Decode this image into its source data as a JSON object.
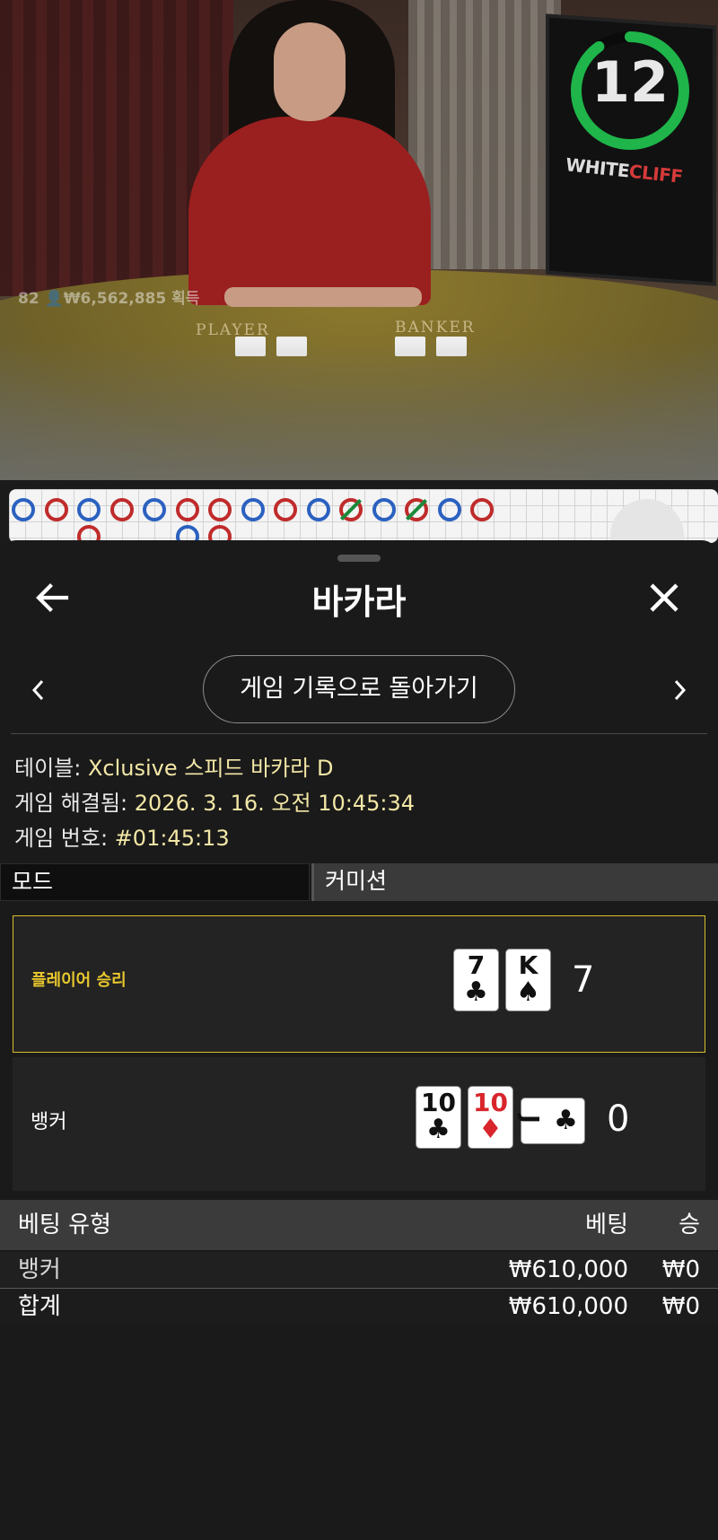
{
  "video": {
    "timer_value": "12",
    "win_text": "82 👤₩6,562,885 획득",
    "felt_player_label": "PLAYER",
    "felt_banker_label": "BANKER",
    "monitor_logo_white": "WHITE",
    "monitor_logo_red": "CLIFF",
    "timer_color": "#1fb54a"
  },
  "road": {
    "beads": [
      "B",
      "R",
      "B",
      "R",
      "B",
      "R",
      "R",
      "B",
      "R",
      "B",
      "T",
      "B",
      "T",
      "B",
      "R"
    ],
    "colors": {
      "banker": "#c02b2b",
      "player": "#2b61c0",
      "tie": "#1a8a3a"
    }
  },
  "header": {
    "title": "바카라",
    "back_icon": "arrow-left-icon",
    "close_icon": "close-icon"
  },
  "nav": {
    "back_to_history_label": "게임 기록으로 돌아가기",
    "prev_icon": "chevron-left-icon",
    "next_icon": "chevron-right-icon"
  },
  "info": {
    "table_label": "테이블:",
    "table_value": "Xclusive 스피드 바카라 D",
    "resolved_label": "게임 해결됨:",
    "resolved_value": "2026. 3. 16. 오전 10:45:34",
    "game_no_label": "게임 번호:",
    "game_no_value": "#01:45:13"
  },
  "tabs": {
    "mode_label": "모드",
    "commission_label": "커미션"
  },
  "results": {
    "player": {
      "label": "플레이어 승리",
      "cards": [
        {
          "rank": "7",
          "suit": "♣"
        },
        {
          "rank": "K",
          "suit": "♠"
        }
      ],
      "score": "7"
    },
    "banker": {
      "label": "뱅커",
      "cards": [
        {
          "rank": "10",
          "suit": "♣"
        },
        {
          "rank": "10",
          "suit": "♦"
        },
        {
          "rank": "J",
          "suit": "♣"
        }
      ],
      "score": "0"
    },
    "highlight_color": "#d9bf2e"
  },
  "bets": {
    "header": {
      "type": "베팅 유형",
      "bet": "베팅",
      "win": "승"
    },
    "rows": [
      {
        "type": "뱅커",
        "bet": "₩610,000",
        "win": "₩0"
      }
    ],
    "total": {
      "type": "합계",
      "bet": "₩610,000",
      "win": "₩0"
    }
  }
}
